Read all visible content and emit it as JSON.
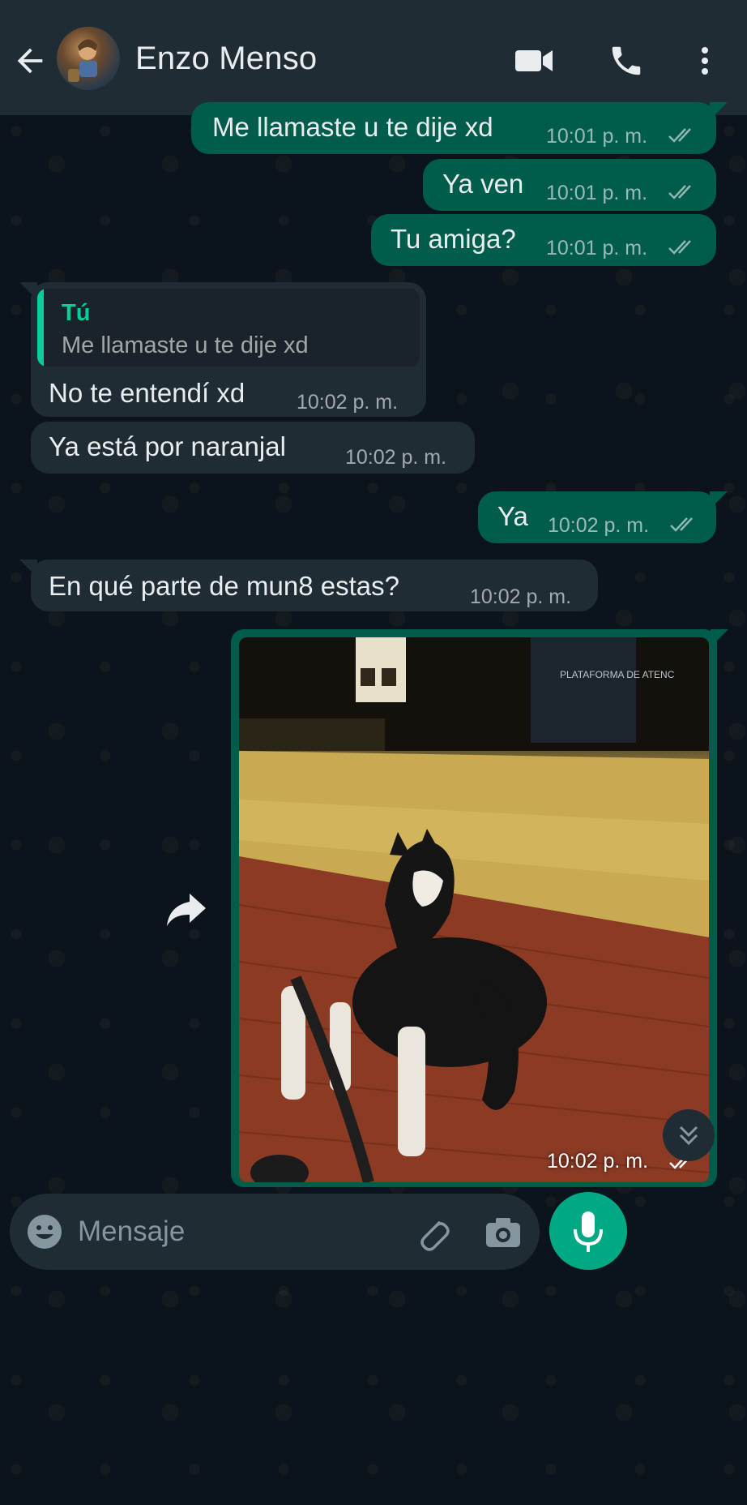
{
  "header": {
    "contact_name": "Enzo Menso",
    "icons": [
      "back-icon",
      "video-call-icon",
      "voice-call-icon",
      "more-options-icon"
    ]
  },
  "messages": [
    {
      "direction": "out",
      "text": "Me llamaste u te dije xd",
      "time": "10:01 p. m.",
      "status": "read"
    },
    {
      "direction": "out",
      "text": "Ya ven",
      "time": "10:01 p. m.",
      "status": "read"
    },
    {
      "direction": "out",
      "text": "Tu amiga?",
      "time": "10:01 p. m.",
      "status": "read"
    },
    {
      "direction": "in",
      "quote_author": "Tú",
      "quote_text": "Me llamaste u te dije xd",
      "text": "No te entendí xd",
      "time": "10:02 p. m."
    },
    {
      "direction": "in",
      "text": "Ya está por naranjal",
      "time": "10:02 p. m."
    },
    {
      "direction": "out",
      "text": "Ya",
      "time": "10:02 p. m.",
      "status": "read"
    },
    {
      "direction": "in",
      "text": "En qué parte de mun8 estas?",
      "time": "10:02 p. m."
    },
    {
      "direction": "out",
      "type": "image",
      "image_desc": "husky",
      "sign_text": "PLATAFORMA DE ATENC",
      "time": "10:02 p. m.",
      "status": "read"
    }
  ],
  "input": {
    "placeholder": "Mensaje"
  },
  "colors": {
    "outgoing_bubble": "#005c4b",
    "incoming_bubble": "#1f2c34",
    "accent": "#00a884",
    "quote_author": "#06cf9c"
  }
}
